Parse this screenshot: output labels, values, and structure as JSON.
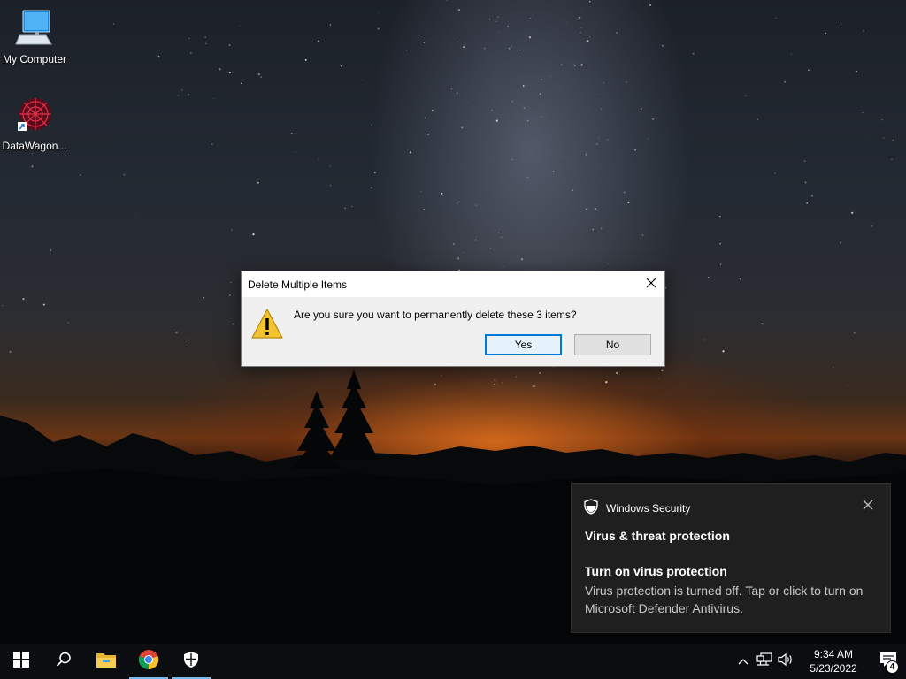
{
  "desktop": {
    "icons": [
      {
        "label": "My Computer",
        "icon": "monitor-icon"
      },
      {
        "label": "DataWagon...",
        "icon": "datawagon-app-icon"
      }
    ]
  },
  "dialog": {
    "title": "Delete Multiple Items",
    "message": "Are you sure you want to permanently delete these 3 items?",
    "yes_label": "Yes",
    "no_label": "No",
    "icon": "warning-icon"
  },
  "toast": {
    "app_name": "Windows Security",
    "title": "Virus & threat protection",
    "subtitle": "Turn on virus protection",
    "body": "Virus protection is turned off. Tap or click to turn on Microsoft Defender Antivirus.",
    "icon": "shield-icon"
  },
  "taskbar": {
    "items": [
      "start-icon",
      "search-icon",
      "file-explorer-icon",
      "chrome-icon",
      "windows-security-icon"
    ],
    "tray": [
      "chevron-up-icon",
      "network-icon",
      "volume-icon"
    ],
    "time": "9:34 AM",
    "date": "5/23/2022",
    "notification_count": "4"
  },
  "colors": {
    "accent": "#0078d7",
    "taskbar_bg": "#0b0d10",
    "toast_bg": "#1f1f1f",
    "dialog_bg": "#f0f0f0"
  }
}
